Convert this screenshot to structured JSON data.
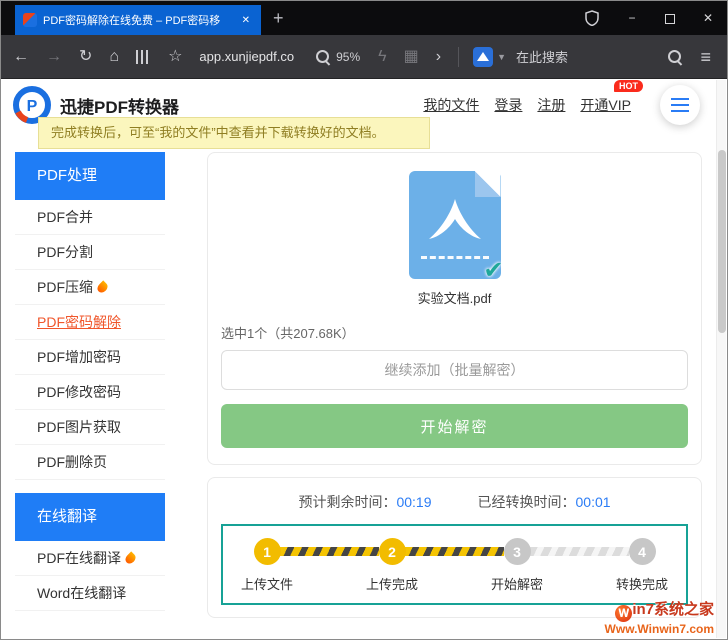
{
  "colors": {
    "tab_blue": "#0a63d2",
    "sidebar_blue": "#1f7df6",
    "active_link_orange": "#f0562b",
    "green_button": "#85c884",
    "teal_border": "#17a296",
    "step_done_yellow": "#f2bc00",
    "step_pending_gray": "#c7c7c7",
    "time_value_blue": "#2b7cf5",
    "tooltip_yellow": "#fbf6bd"
  },
  "titlebar": {
    "tab_title": "PDF密码解除在线免费 – PDF密码移",
    "tab_close": "✕",
    "new_tab": "+",
    "minimize": "−",
    "close": "✕"
  },
  "toolbar": {
    "back": "←",
    "forward": "→",
    "reload": "↻",
    "home": "⌂",
    "bookmark_star": "☆",
    "url": "app.xunjiepdf.co",
    "zoom_level": "95%",
    "bolt": "ϟ",
    "grid": "▦",
    "chevron": "›",
    "engine_caret": "▼",
    "search_label": "在此搜索",
    "menu": "≡"
  },
  "site_header": {
    "brand": "迅捷PDF转换器",
    "nav_my_files": "我的文件",
    "nav_login": "登录",
    "nav_register": "注册",
    "nav_vip": "开通VIP",
    "hot_badge": "HOT"
  },
  "tooltip": {
    "text": "完成转换后，可至“我的文件”中查看并下载转换好的文档。"
  },
  "sidebar": {
    "sections": [
      {
        "header": "PDF处理",
        "items": [
          {
            "label": "PDF合并"
          },
          {
            "label": "PDF分割"
          },
          {
            "label": "PDF压缩",
            "hot": true
          },
          {
            "label": "PDF密码解除",
            "active": true
          },
          {
            "label": "PDF增加密码"
          },
          {
            "label": "PDF修改密码"
          },
          {
            "label": "PDF图片获取"
          },
          {
            "label": "PDF删除页"
          }
        ]
      },
      {
        "header": "在线翻译",
        "items": [
          {
            "label": "PDF在线翻译",
            "hot": true
          },
          {
            "label": "Word在线翻译"
          }
        ]
      }
    ]
  },
  "main": {
    "file_name": "实验文档.pdf",
    "selection_info": "选中1个（共207.68K）",
    "add_more_button": "继续添加（批量解密）",
    "start_button": "开始解密",
    "check_mark": "✔",
    "progress": {
      "remaining_label": "预计剩余时间：",
      "remaining_value": "00:19",
      "elapsed_label": "已经转换时间：",
      "elapsed_value": "00:01",
      "steps": [
        {
          "num": "1",
          "label": "上传文件",
          "state": "done"
        },
        {
          "num": "2",
          "label": "上传完成",
          "state": "done"
        },
        {
          "num": "3",
          "label": "开始解密",
          "state": "pending"
        },
        {
          "num": "4",
          "label": "转换完成",
          "state": "pending"
        }
      ]
    }
  },
  "watermark": {
    "logo_letter": "W",
    "site_name": "in7系统之家",
    "site_url": "Www.Winwin7.com"
  }
}
